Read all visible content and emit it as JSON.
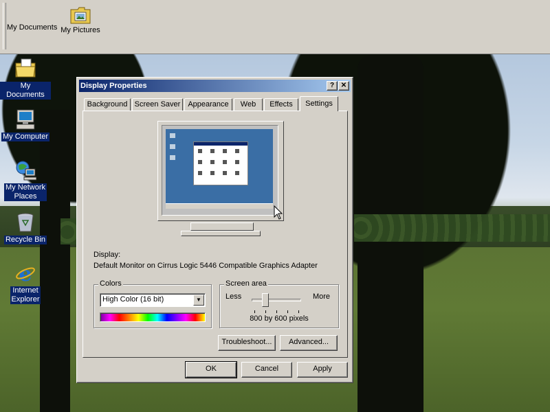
{
  "quicklaunch": {
    "items": [
      {
        "label": "My Documents"
      },
      {
        "label": "My Pictures"
      }
    ]
  },
  "desktop_icons": [
    {
      "label": "My Documents",
      "icon": "folder-documents-icon"
    },
    {
      "label": "My Computer",
      "icon": "computer-icon"
    },
    {
      "label_lines": [
        "My Network",
        "Places"
      ],
      "icon": "network-places-icon"
    },
    {
      "label": "Recycle Bin",
      "icon": "recycle-bin-icon"
    },
    {
      "label_lines": [
        "Internet",
        "Explorer"
      ],
      "icon": "internet-explorer-icon"
    }
  ],
  "dialog": {
    "title": "Display Properties",
    "help_button": "?",
    "close_button": "✕",
    "tabs": [
      {
        "label": "Background"
      },
      {
        "label": "Screen Saver"
      },
      {
        "label": "Appearance"
      },
      {
        "label": "Web"
      },
      {
        "label": "Effects"
      },
      {
        "label": "Settings",
        "active": true
      }
    ],
    "display_label": "Display:",
    "display_value": "Default Monitor on Cirrus Logic 5446 Compatible Graphics Adapter",
    "colors": {
      "legend": "Colors",
      "selected": "High Color (16 bit)"
    },
    "screen_area": {
      "legend": "Screen area",
      "less": "Less",
      "more": "More",
      "value_text": "800 by 600 pixels",
      "slider_position": 0.28
    },
    "buttons": {
      "troubleshoot": "Troubleshoot...",
      "advanced": "Advanced...",
      "ok": "OK",
      "cancel": "Cancel",
      "apply": "Apply"
    }
  },
  "colors": {
    "title_bar_start": "#0a246a",
    "title_bar_end": "#a6caf0",
    "face": "#d4d0c8",
    "preview_desktop": "#3a6ea5",
    "icon_label_bg": "#0a246a"
  }
}
